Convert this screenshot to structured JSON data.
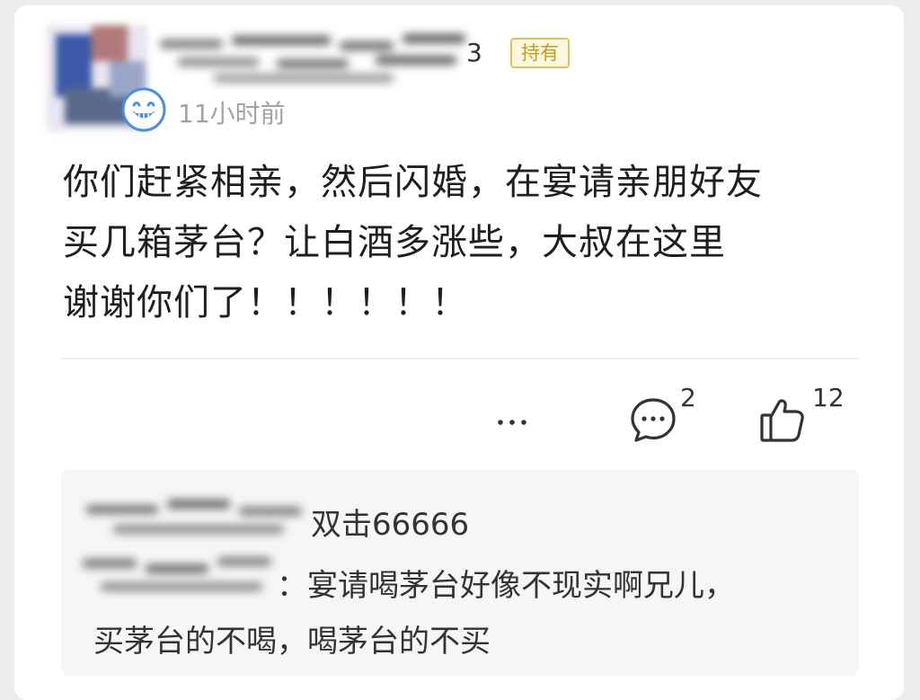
{
  "post": {
    "badge": "持有",
    "time": "11小时前",
    "content": "你们赶紧相亲，然后闪婚，在宴请亲朋好友\n买几箱茅台？让白酒多涨些，大叔在这里\n谢谢你们了！！！！！！",
    "comment_count": "2",
    "like_count": "12"
  },
  "replies": [
    {
      "text": "双击66666"
    },
    {
      "text_line1": "：宴请喝茅台好像不现实啊兄儿，",
      "text_line2": "买茅台的不喝，喝茅台的不买"
    }
  ],
  "icons": {
    "more": "more-icon",
    "comment": "comment-icon",
    "like": "like-icon",
    "smile": "smile-badge-icon"
  },
  "colors": {
    "badge_border": "#e3c15a",
    "badge_text": "#c99a1a",
    "time_text": "#a3a3a3",
    "reply_bg": "#f6f6f6",
    "smile_blue": "#4a8fe0"
  }
}
